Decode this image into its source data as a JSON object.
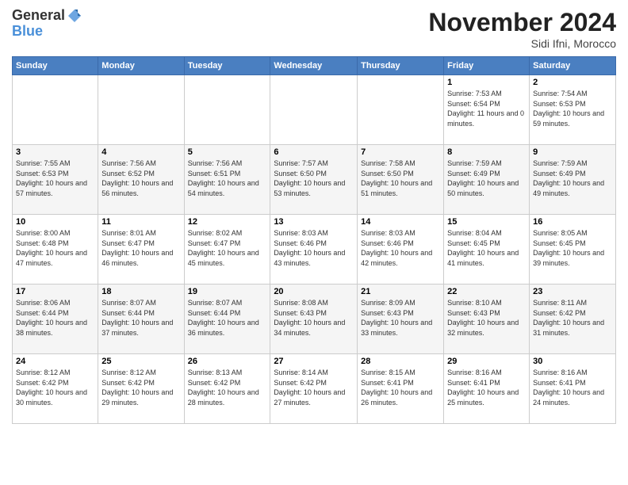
{
  "header": {
    "logo_line1": "General",
    "logo_line2": "Blue",
    "month_title": "November 2024",
    "subtitle": "Sidi Ifni, Morocco"
  },
  "days_of_week": [
    "Sunday",
    "Monday",
    "Tuesday",
    "Wednesday",
    "Thursday",
    "Friday",
    "Saturday"
  ],
  "weeks": [
    [
      {
        "day": "",
        "info": ""
      },
      {
        "day": "",
        "info": ""
      },
      {
        "day": "",
        "info": ""
      },
      {
        "day": "",
        "info": ""
      },
      {
        "day": "",
        "info": ""
      },
      {
        "day": "1",
        "info": "Sunrise: 7:53 AM\nSunset: 6:54 PM\nDaylight: 11 hours and 0 minutes."
      },
      {
        "day": "2",
        "info": "Sunrise: 7:54 AM\nSunset: 6:53 PM\nDaylight: 10 hours and 59 minutes."
      }
    ],
    [
      {
        "day": "3",
        "info": "Sunrise: 7:55 AM\nSunset: 6:53 PM\nDaylight: 10 hours and 57 minutes."
      },
      {
        "day": "4",
        "info": "Sunrise: 7:56 AM\nSunset: 6:52 PM\nDaylight: 10 hours and 56 minutes."
      },
      {
        "day": "5",
        "info": "Sunrise: 7:56 AM\nSunset: 6:51 PM\nDaylight: 10 hours and 54 minutes."
      },
      {
        "day": "6",
        "info": "Sunrise: 7:57 AM\nSunset: 6:50 PM\nDaylight: 10 hours and 53 minutes."
      },
      {
        "day": "7",
        "info": "Sunrise: 7:58 AM\nSunset: 6:50 PM\nDaylight: 10 hours and 51 minutes."
      },
      {
        "day": "8",
        "info": "Sunrise: 7:59 AM\nSunset: 6:49 PM\nDaylight: 10 hours and 50 minutes."
      },
      {
        "day": "9",
        "info": "Sunrise: 7:59 AM\nSunset: 6:49 PM\nDaylight: 10 hours and 49 minutes."
      }
    ],
    [
      {
        "day": "10",
        "info": "Sunrise: 8:00 AM\nSunset: 6:48 PM\nDaylight: 10 hours and 47 minutes."
      },
      {
        "day": "11",
        "info": "Sunrise: 8:01 AM\nSunset: 6:47 PM\nDaylight: 10 hours and 46 minutes."
      },
      {
        "day": "12",
        "info": "Sunrise: 8:02 AM\nSunset: 6:47 PM\nDaylight: 10 hours and 45 minutes."
      },
      {
        "day": "13",
        "info": "Sunrise: 8:03 AM\nSunset: 6:46 PM\nDaylight: 10 hours and 43 minutes."
      },
      {
        "day": "14",
        "info": "Sunrise: 8:03 AM\nSunset: 6:46 PM\nDaylight: 10 hours and 42 minutes."
      },
      {
        "day": "15",
        "info": "Sunrise: 8:04 AM\nSunset: 6:45 PM\nDaylight: 10 hours and 41 minutes."
      },
      {
        "day": "16",
        "info": "Sunrise: 8:05 AM\nSunset: 6:45 PM\nDaylight: 10 hours and 39 minutes."
      }
    ],
    [
      {
        "day": "17",
        "info": "Sunrise: 8:06 AM\nSunset: 6:44 PM\nDaylight: 10 hours and 38 minutes."
      },
      {
        "day": "18",
        "info": "Sunrise: 8:07 AM\nSunset: 6:44 PM\nDaylight: 10 hours and 37 minutes."
      },
      {
        "day": "19",
        "info": "Sunrise: 8:07 AM\nSunset: 6:44 PM\nDaylight: 10 hours and 36 minutes."
      },
      {
        "day": "20",
        "info": "Sunrise: 8:08 AM\nSunset: 6:43 PM\nDaylight: 10 hours and 34 minutes."
      },
      {
        "day": "21",
        "info": "Sunrise: 8:09 AM\nSunset: 6:43 PM\nDaylight: 10 hours and 33 minutes."
      },
      {
        "day": "22",
        "info": "Sunrise: 8:10 AM\nSunset: 6:43 PM\nDaylight: 10 hours and 32 minutes."
      },
      {
        "day": "23",
        "info": "Sunrise: 8:11 AM\nSunset: 6:42 PM\nDaylight: 10 hours and 31 minutes."
      }
    ],
    [
      {
        "day": "24",
        "info": "Sunrise: 8:12 AM\nSunset: 6:42 PM\nDaylight: 10 hours and 30 minutes."
      },
      {
        "day": "25",
        "info": "Sunrise: 8:12 AM\nSunset: 6:42 PM\nDaylight: 10 hours and 29 minutes."
      },
      {
        "day": "26",
        "info": "Sunrise: 8:13 AM\nSunset: 6:42 PM\nDaylight: 10 hours and 28 minutes."
      },
      {
        "day": "27",
        "info": "Sunrise: 8:14 AM\nSunset: 6:42 PM\nDaylight: 10 hours and 27 minutes."
      },
      {
        "day": "28",
        "info": "Sunrise: 8:15 AM\nSunset: 6:41 PM\nDaylight: 10 hours and 26 minutes."
      },
      {
        "day": "29",
        "info": "Sunrise: 8:16 AM\nSunset: 6:41 PM\nDaylight: 10 hours and 25 minutes."
      },
      {
        "day": "30",
        "info": "Sunrise: 8:16 AM\nSunset: 6:41 PM\nDaylight: 10 hours and 24 minutes."
      }
    ]
  ]
}
